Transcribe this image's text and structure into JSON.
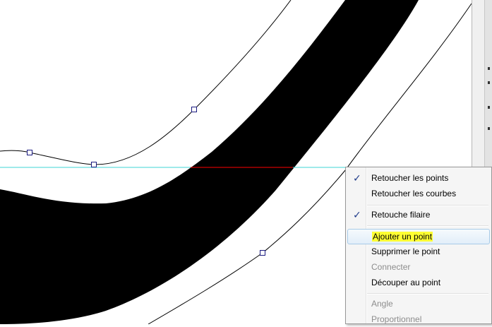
{
  "colors": {
    "guide_line": "#3fd6d6",
    "intersection_segment": "#ff0000",
    "stroke_fill": "#000000",
    "node_outline": "#1a1a80",
    "highlight": "#ffff33",
    "check": "#1f3b8a"
  },
  "context_menu": {
    "items": [
      {
        "label": "Retoucher les points",
        "checked": true,
        "enabled": true
      },
      {
        "label": "Retoucher les courbes",
        "checked": false,
        "enabled": true
      },
      {
        "label": "Retouche filaire",
        "checked": true,
        "enabled": true
      },
      {
        "label": "Ajouter un point",
        "checked": false,
        "enabled": true,
        "hovered": true,
        "highlighted": true
      },
      {
        "label": "Supprimer le point",
        "checked": false,
        "enabled": true
      },
      {
        "label": "Connecter",
        "checked": false,
        "enabled": false
      },
      {
        "label": "Découper au point",
        "checked": false,
        "enabled": true
      },
      {
        "label": "Angle",
        "checked": false,
        "enabled": false
      },
      {
        "label": "Proportionnel",
        "checked": false,
        "enabled": false
      }
    ],
    "check_glyph": "✓"
  }
}
